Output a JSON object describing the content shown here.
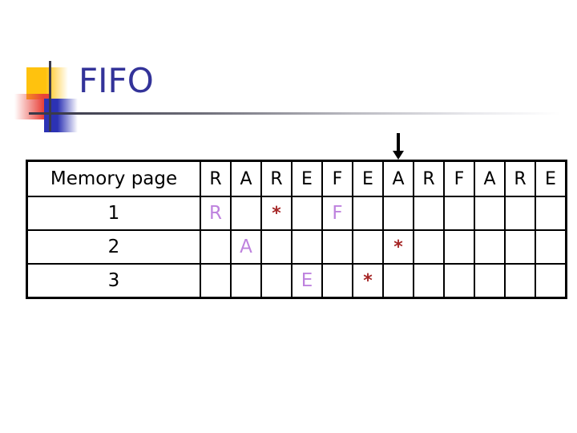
{
  "slide": {
    "title": "FIFO",
    "title_color": "#333399",
    "decoration": {
      "yellow": "#FFC20E",
      "red": "#E8423A",
      "blue": "#2C32B4",
      "line": "#3A3A4A"
    }
  },
  "colors": {
    "page_letter": "#BE82DE",
    "page_fault": "#A52525",
    "grid": "#000000"
  },
  "table": {
    "row_label_header": "Memory page",
    "reference_string": [
      "R",
      "A",
      "R",
      "E",
      "F",
      "E",
      "A",
      "R",
      "F",
      "A",
      "R",
      "E"
    ],
    "rows": [
      {
        "label": "1",
        "cells": [
          "R",
          "",
          "*",
          "",
          "F",
          "",
          "",
          "",
          "",
          "",
          "",
          ""
        ]
      },
      {
        "label": "2",
        "cells": [
          "",
          "A",
          "",
          "",
          "",
          "",
          "*",
          "",
          "",
          "",
          "",
          ""
        ]
      },
      {
        "label": "3",
        "cells": [
          "",
          "",
          "",
          "E",
          "",
          "*",
          "",
          "",
          "",
          "",
          "",
          ""
        ]
      }
    ],
    "arrow": {
      "icon": "down-arrow-icon",
      "target_column_index": 6
    }
  }
}
